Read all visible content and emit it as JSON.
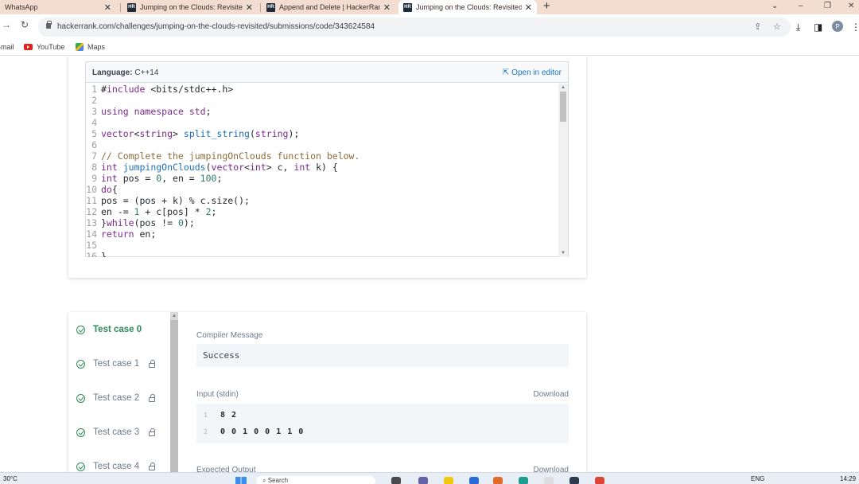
{
  "browser": {
    "tabs": [
      {
        "label": "WhatsApp",
        "favicon": ""
      },
      {
        "label": "Jumping on the Clouds: Revisited",
        "favicon": "HR"
      },
      {
        "label": "Append and Delete | HackerRank",
        "favicon": "HR"
      },
      {
        "label": "Jumping on the Clouds: Revisited",
        "favicon": "HR"
      }
    ],
    "new_tab": "+",
    "close_glyph": "✕",
    "url": "hackerrank.com/challenges/jumping-on-the-clouds-revisited/submissions/code/343624584",
    "profile_initial": "P",
    "bookmarks": [
      {
        "label": "Gmail"
      },
      {
        "label": "YouTube"
      },
      {
        "label": "Maps"
      }
    ]
  },
  "editor": {
    "language_label": "Language:",
    "language_value": "C++14",
    "open_in_editor": "Open in editor",
    "lines": [
      {
        "num": "1",
        "text": "#include <bits/stdc++.h>"
      },
      {
        "num": "2",
        "text": ""
      },
      {
        "num": "3",
        "text": "using namespace std;"
      },
      {
        "num": "4",
        "text": ""
      },
      {
        "num": "5",
        "text": "vector<string> split_string(string);"
      },
      {
        "num": "6",
        "text": ""
      },
      {
        "num": "7",
        "text": "// Complete the jumpingOnClouds function below."
      },
      {
        "num": "8",
        "text": "int jumpingOnClouds(vector<int> c, int k) {"
      },
      {
        "num": "9",
        "text": "int pos = 0, en = 100;"
      },
      {
        "num": "10",
        "text": "do{"
      },
      {
        "num": "11",
        "text": "pos = (pos + k) % c.size();"
      },
      {
        "num": "12",
        "text": "en -= 1 + c[pos] * 2;"
      },
      {
        "num": "13",
        "text": "}while(pos != 0);"
      },
      {
        "num": "14",
        "text": "return en;"
      },
      {
        "num": "15",
        "text": ""
      },
      {
        "num": "16",
        "text": "}"
      }
    ]
  },
  "tests": {
    "cases": [
      {
        "label": "Test case 0",
        "active": true,
        "locked": false
      },
      {
        "label": "Test case 1",
        "active": false,
        "locked": true
      },
      {
        "label": "Test case 2",
        "active": false,
        "locked": true
      },
      {
        "label": "Test case 3",
        "active": false,
        "locked": true
      },
      {
        "label": "Test case 4",
        "active": false,
        "locked": true
      }
    ],
    "compiler_message_label": "Compiler Message",
    "compiler_message": "Success",
    "input_label": "Input (stdin)",
    "download_label": "Download",
    "input_lines": [
      {
        "num": "1",
        "text": "8 2"
      },
      {
        "num": "2",
        "text": "0 0 1 0 0 1 1 0"
      }
    ],
    "expected_output_label": "Expected Output"
  },
  "taskbar": {
    "temperature": "30°C",
    "search_placeholder": "Search",
    "language": "ENG",
    "clock": "14:29"
  }
}
